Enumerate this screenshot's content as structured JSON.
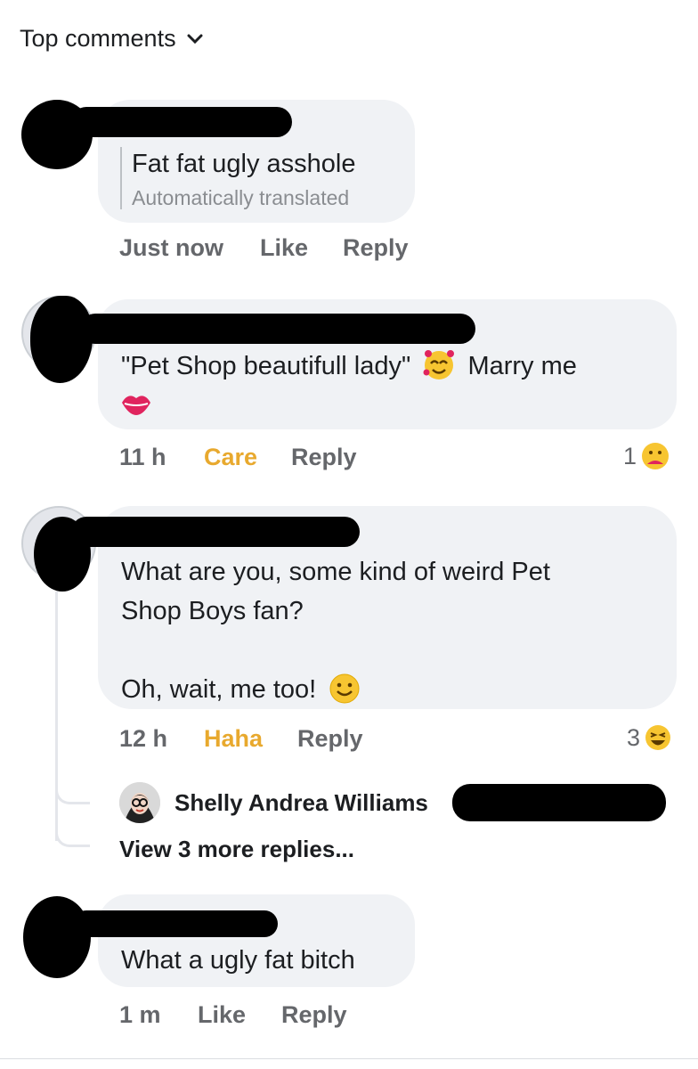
{
  "header": {
    "sort_label": "Top comments"
  },
  "comments": [
    {
      "text": "Fat fat ugly asshole",
      "translation_note": "Automatically translated",
      "time": "Just now",
      "action": "Like",
      "reply": "Reply"
    },
    {
      "text_a": "\"Pet Shop beautifull lady\"",
      "text_b": "Marry me",
      "time": "11 h",
      "action": "Care",
      "reply": "Reply",
      "reaction_count": "1"
    },
    {
      "line1": "What are you, some kind of weird Pet",
      "line2": "Shop Boys fan?",
      "line3": "Oh, wait, me too!",
      "time": "12 h",
      "action": "Haha",
      "reply": "Reply",
      "reaction_count": "3",
      "reply_preview_name": "Shelly Andrea Williams",
      "view_more": "View 3 more replies..."
    },
    {
      "text": "What a ugly fat bitch",
      "time": "1 m",
      "action": "Like",
      "reply": "Reply"
    }
  ],
  "colors": {
    "bubble": "#f0f2f5",
    "meta": "#65676b",
    "care_haha": "#e8a92e",
    "redaction": "#000000"
  }
}
